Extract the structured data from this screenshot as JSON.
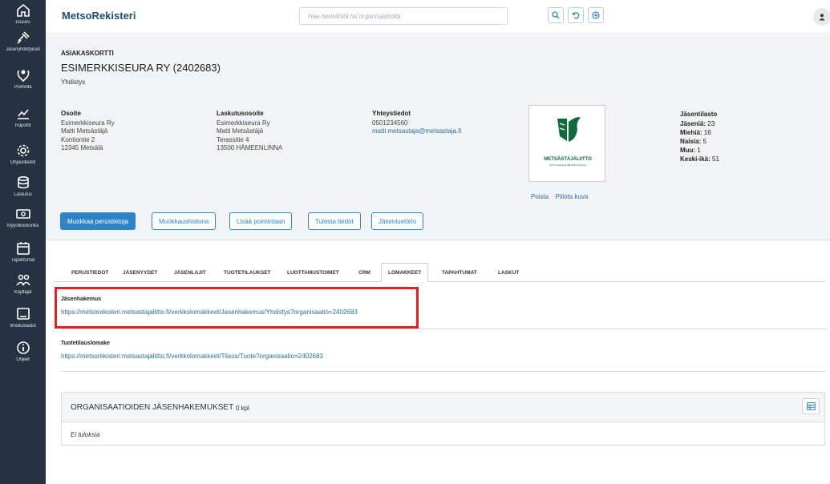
{
  "nav": [
    {
      "label": "Etusivu",
      "icon": "home-icon"
    },
    {
      "label": "Jäsenyhdistykset",
      "icon": "gavel-icon"
    },
    {
      "label": "Poiminta",
      "icon": "people-icon"
    },
    {
      "label": "Raportit",
      "icon": "chart-icon"
    },
    {
      "label": "Ohjaustiedot",
      "icon": "gear-icon"
    },
    {
      "label": "Laskutus",
      "icon": "database-icon"
    },
    {
      "label": "Myyntireskontra",
      "icon": "money-icon"
    },
    {
      "label": "Tapahtumat",
      "icon": "calendar-icon"
    },
    {
      "label": "Käyttäjät",
      "icon": "users-icon"
    },
    {
      "label": "Ilmoitustaulut",
      "icon": "board-icon"
    },
    {
      "label": "Ohjeet",
      "icon": "info-icon"
    }
  ],
  "header": {
    "brand": "MetsoRekisteri",
    "search_placeholder": "Hae henkilöitä tai organisaatioita",
    "actions": [
      "search-icon",
      "history-icon",
      "plus-icon"
    ],
    "user_icon": "user-icon"
  },
  "card": {
    "kicker": "ASIAKASKORTTI",
    "name": "ESIMERKKISEURA RY (2402683)",
    "type": "Yhdistys",
    "address": {
      "heading": "Osoite",
      "lines": [
        "Esimerkkiseura Ry",
        "Matti Metsästäjä",
        "Kontiontie 2",
        "12345 Metsälä"
      ]
    },
    "billing": {
      "heading": "Laskutusosoite",
      "lines": [
        "Esimerkkiseura Ry",
        "Matti Metsästäjä",
        "Terassitie 4",
        "13500 HÄMEENLINNA"
      ]
    },
    "contact": {
      "heading": "Yhteystiedot",
      "phone": "0501234560",
      "email": "matti.metsastaja@metsastaja.fi"
    },
    "logo": {
      "text": "METSÄSTÄJÄLIITTO",
      "subtext": "KOTI KAIKILLE METSÄSTÄJILLE",
      "remove": "Poista",
      "hide": "Piilota kuva"
    },
    "stats": {
      "heading": "Jäsentilasto",
      "members_label": "Jäseniä:",
      "members": "23",
      "men_label": "Miehiä:",
      "men": "16",
      "women_label": "Naisia:",
      "women": "5",
      "other_label": "Muu:",
      "other": "1",
      "avg_age_label": "Keski-ikä:",
      "avg_age": "51"
    },
    "buttons": {
      "edit": "Muokkaa perustietoja",
      "history": "Muokkaushistoria",
      "add_pick": "Lisää poimintaan",
      "print": "Tulosta tiedot",
      "members": "Jäsenluettelo"
    }
  },
  "tabs": [
    "PERUSTIEDOT",
    "JÄSENYYDET",
    "JÄSENLAJIT",
    "TUOTETILAUKSET",
    "LUOTTAMUSTOIMET",
    "CRM",
    "LOMAKKEET",
    "TAPAHTUMAT",
    "LASKUT"
  ],
  "active_tab": "LOMAKKEET",
  "forms": [
    {
      "title": "Jäsenhakemus",
      "url": "https://metsorekisteri.metsastajaliitto.fi/verkkolomakkeet/Jasenhakemus/Yhdistys?organisaatio=2402683"
    },
    {
      "title": "Tuotetilauslomake",
      "url": "https://metsorekisteri.metsastajaliitto.fi/verkkolomakkeet/Tilaus/Tuote?organisaatio=2402683"
    }
  ],
  "panel": {
    "title": "ORGANISAATIOIDEN JÄSENHAKEMUKSET",
    "count": "0 kpl",
    "empty": "Ei tuloksia",
    "tool_icon": "table-icon"
  },
  "colors": {
    "sidebar": "#263242",
    "primary": "#2f83c9",
    "link": "#2b6ea6",
    "highlight": "#e0202b",
    "logo_green": "#0f6b3c"
  }
}
